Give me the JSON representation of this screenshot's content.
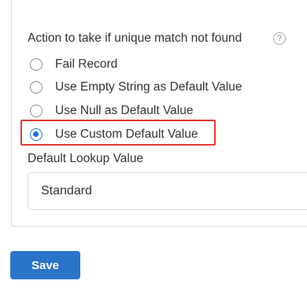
{
  "action_section": {
    "label": "Action to take if unique match not found",
    "help_glyph": "?",
    "options": [
      {
        "label": "Fail Record",
        "checked": false
      },
      {
        "label": "Use Empty String as Default Value",
        "checked": false
      },
      {
        "label": "Use Null as Default Value",
        "checked": false
      },
      {
        "label": "Use Custom Default Value",
        "checked": true
      }
    ],
    "highlight_color": "#e53935"
  },
  "default_lookup": {
    "label": "Default Lookup Value",
    "value": "Standard"
  },
  "footer": {
    "save_label": "Save",
    "accent_color": "#2a74c9"
  }
}
